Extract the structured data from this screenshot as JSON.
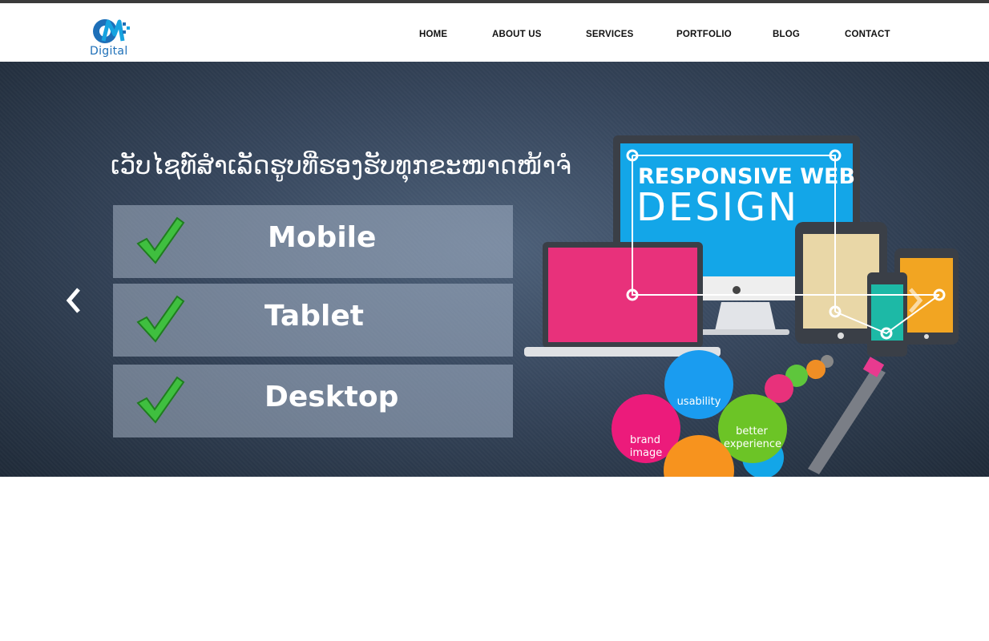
{
  "brand": {
    "logo_text": "Digital"
  },
  "nav": {
    "items": [
      "HOME",
      "ABOUT US",
      "SERVICES",
      "PORTFOLIO",
      "BLOG",
      "CONTACT"
    ]
  },
  "hero": {
    "headline": "ເວັບໄຊທ໌ສຳເລັດຮູບທີ່ຮອງຮັບທຸກຂະໜາດໜ້າຈໍ",
    "panels": [
      "Mobile",
      "Tablet",
      "Desktop"
    ],
    "art": {
      "title_line1": "RESPONSIVE WEB",
      "title_line2": "DESIGN",
      "bubble_usability": "usability",
      "bubble_better": "better",
      "bubble_experience": "experience",
      "bubble_brand": "brand",
      "bubble_image": "image"
    }
  },
  "icons": {
    "prev": "chevron-left-icon",
    "next": "chevron-right-icon",
    "check": "check-mark-icon"
  },
  "colors": {
    "topbar": "#3b3b3b",
    "logo_blue": "#1d6fb8",
    "check_green": "#3fbf3f",
    "screen_blue": "#13a6e8",
    "laptop_pink": "#e8317b",
    "tablet_beige": "#e9d7a7",
    "tablet_orange": "#f2a522",
    "phone_teal": "#1db9a6"
  }
}
